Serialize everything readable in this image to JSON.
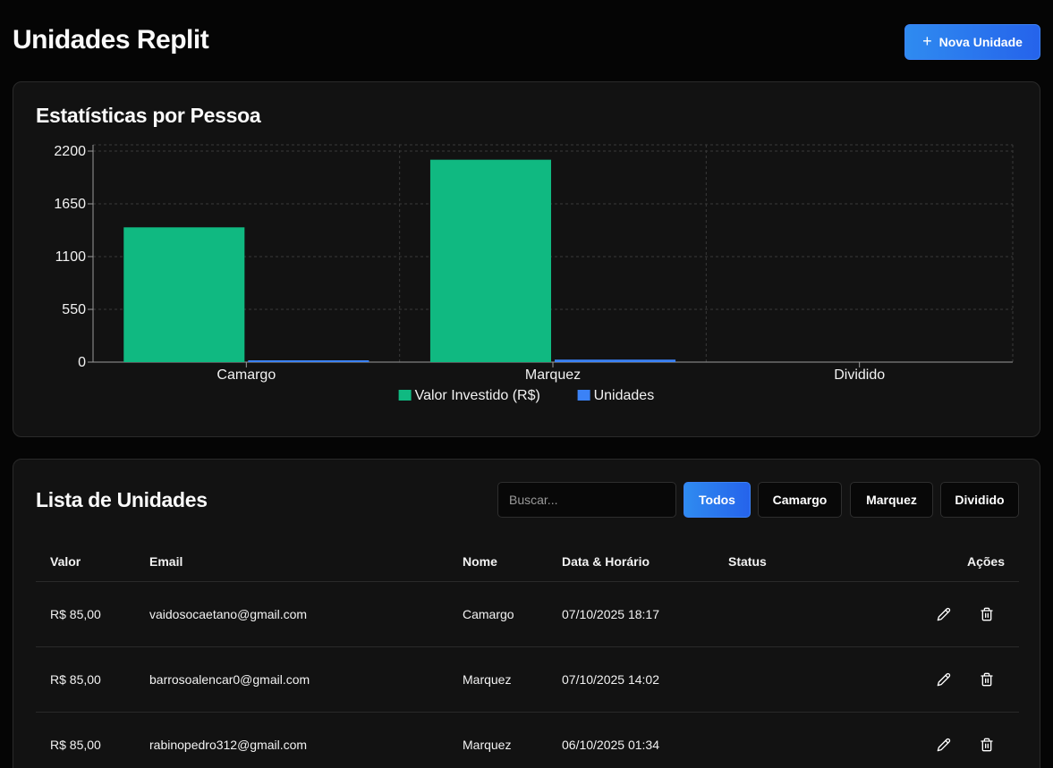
{
  "header": {
    "title": "Unidades Replit",
    "new_button": "Nova Unidade"
  },
  "stats": {
    "title": "Estatísticas por Pessoa"
  },
  "chart_data": {
    "type": "bar",
    "categories": [
      "Camargo",
      "Marquez",
      "Dividido"
    ],
    "series": [
      {
        "name": "Valor Investido (R$)",
        "values": [
          1405,
          2110,
          0
        ],
        "color": "#10b981"
      },
      {
        "name": "Unidades",
        "values": [
          17,
          26,
          0
        ],
        "color": "#3b82f6"
      }
    ],
    "yticks": [
      0,
      550,
      1100,
      1650,
      2200
    ],
    "ylim": [
      0,
      2200
    ],
    "grid": true,
    "legend": "bottom"
  },
  "list": {
    "title": "Lista de Unidades",
    "search_placeholder": "Buscar...",
    "filters": [
      "Todos",
      "Camargo",
      "Marquez",
      "Dividido"
    ],
    "active_filter": "Todos",
    "columns": {
      "valor": "Valor",
      "email": "Email",
      "nome": "Nome",
      "data": "Data & Horário",
      "status": "Status",
      "acoes": "Ações"
    },
    "rows": [
      {
        "valor": "R$ 85,00",
        "email": "vaidosocaetano@gmail.com",
        "nome": "Camargo",
        "data": "07/10/2025 18:17",
        "status": ""
      },
      {
        "valor": "R$ 85,00",
        "email": "barrosoalencar0@gmail.com",
        "nome": "Marquez",
        "data": "07/10/2025 14:02",
        "status": ""
      },
      {
        "valor": "R$ 85,00",
        "email": "rabinopedro312@gmail.com",
        "nome": "Marquez",
        "data": "06/10/2025 01:34",
        "status": ""
      }
    ]
  }
}
